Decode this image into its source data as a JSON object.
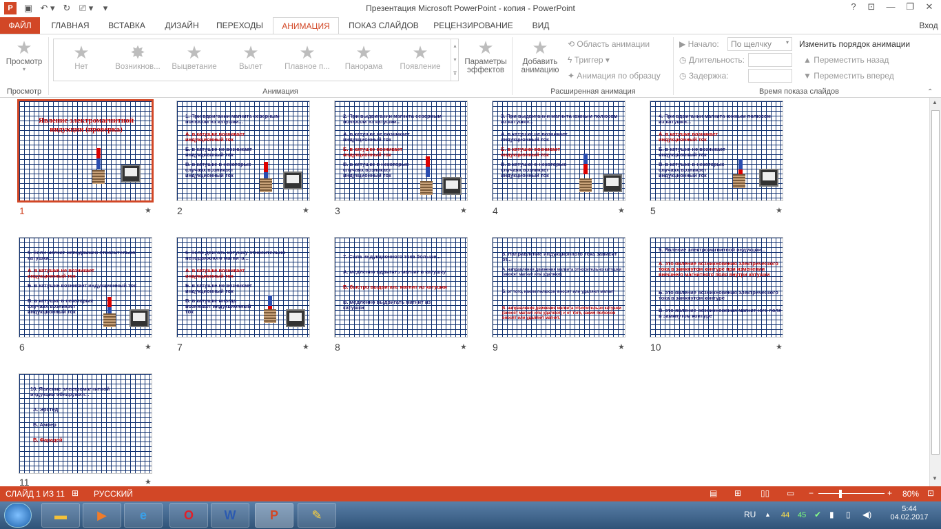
{
  "window": {
    "title": "Презентация Microsoft PowerPoint - копия - PowerPoint",
    "help": "?",
    "sign_in": "Вход"
  },
  "tabs": [
    "ФАЙЛ",
    "ГЛАВНАЯ",
    "ВСТАВКА",
    "ДИЗАЙН",
    "ПЕРЕХОДЫ",
    "АНИМАЦИЯ",
    "ПОКАЗ СЛАЙДОВ",
    "РЕЦЕНЗИРОВАНИЕ",
    "ВИД"
  ],
  "ribbon": {
    "preview": {
      "label": "Просмотр",
      "group": "Просмотр"
    },
    "animation_group": "Анимация",
    "gallery": [
      "Нет",
      "Возникнов...",
      "Выцветание",
      "Вылет",
      "Плавное п...",
      "Панорама",
      "Появление"
    ],
    "effect_params": {
      "line1": "Параметры",
      "line2": "эффектов"
    },
    "add_animation": {
      "line1": "Добавить",
      "line2": "анимацию"
    },
    "advanced": {
      "pane": "Область анимации",
      "trigger": "Триггер",
      "painter": "Анимация по образцу",
      "group": "Расширенная анимация"
    },
    "timing": {
      "start_label": "Начало:",
      "start_value": "По щелчку",
      "duration_label": "Длительность:",
      "delay_label": "Задержка:",
      "group": "Время показа слайдов"
    },
    "reorder": {
      "title": "Изменить порядок анимации",
      "back": "Переместить назад",
      "forward": "Переместить вперед"
    }
  },
  "slides": [
    {
      "num": "1",
      "title": "Явление электромагнитной индукции (проверка)"
    },
    {
      "num": "2",
      "q": "1. При вдвигании магнита северным полюсом из катушки...",
      "a": "А. в катушке возникает индукционный ток",
      "b": "Б. в катушке не возникает индукционный ток",
      "c": "В. в катушке в некоторых случаях возникает индукционный ток"
    },
    {
      "num": "3",
      "q": "2. При выдвигании магнита северным полюсом из катушки...",
      "a": "А. в катушке не возникает индукционный ток",
      "b": "Б. в катушке возникает индукционный ток",
      "c": "В. в катушке в некоторых случаях возникает индукционный ток"
    },
    {
      "num": "4",
      "q": "3. При выдвигании магнита южным полюсом из катушки...",
      "a": "А. в катушке не возникает индукционный ток",
      "b": "Б. в катушке возникает индукционный ток",
      "c": "В. в катушке в некоторых случаях возникает индукционный ток"
    },
    {
      "num": "5",
      "q": "4. При вдвигании магнита южным полюсом из катушки...",
      "a": "А. в катушке возникает индукционный ток",
      "b": "Б. в катушке не возникает индукционный ток",
      "c": "В. в катушке в некоторых случаях возникает индукционный ток"
    },
    {
      "num": "6",
      "q": "5. Если магнит неподвижен относительно катушки...",
      "a": "А. в катушке не возникает индукционный ток",
      "b": "Б. в катушке возникает индукционный ток",
      "c": "В. в катушке в некоторых случаях возникает индукционный ток"
    },
    {
      "num": "7",
      "q": "6. Если двигать катушку относительно неподвижного магнита...",
      "a": "А. в катушке возникает индукционный ток",
      "b": "Б. в катушке не возникает индукционный ток",
      "c": "В. в катушке иногда возникает индукционный ток"
    },
    {
      "num": "8",
      "q": "7. Сила индукционного тока больше...",
      "a": "А. медленно вдвигать магнит в катушку",
      "b": "Б. быстро выдвигать магнит из катушки",
      "c": "В. медленно выдвигать магнит из катушки"
    },
    {
      "num": "9",
      "q": "8. Направление индукционного тока зависит от...",
      "a": "А. направления движения магнита относительно катушки (вносят магнит или удаляют)",
      "b": "Б. от того, каким полюсом вносят или удаляют магнит",
      "c": "В. направления движения магнита относительно катушки (вносят магнит или удаляют) и от того, каким полюсом вносят или удаляют магнит."
    },
    {
      "num": "10",
      "q": "9. Явление электромагнитной индукции...",
      "a": "А. это явление возникновения электрического тока в замкнутом контуре при изменении внешнего магнитного поля внутри катушки",
      "b": "Б. это явление возникновения электрического тока в замкнутом контуре",
      "c": "В. это явление возникновения магнитного поля в замкнутом контуре"
    },
    {
      "num": "11",
      "q": "10. Явление электромагнитной индукции обнаружил...",
      "a": "А. Эрстед",
      "b": "Б. Ампер",
      "c": "В. Фарадей"
    }
  ],
  "status": {
    "slide": "СЛАЙД 1 ИЗ 11",
    "lang": "РУССКИЙ",
    "zoom": "80%"
  },
  "taskbar": {
    "lang": "RU",
    "n1": "44",
    "n2": "45",
    "time": "5:44",
    "date": "04.02.2017"
  }
}
